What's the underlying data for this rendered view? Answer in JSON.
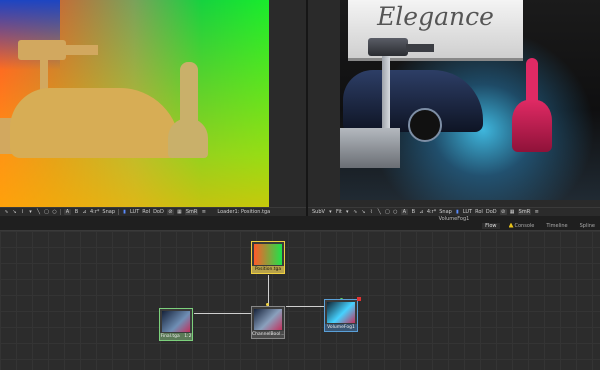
{
  "viewer_left": {
    "toolbar": {
      "icons": [
        "pencil-icon",
        "polyline-icon",
        "bspline-icon",
        "brush-icon",
        "line-icon",
        "rectangle-icon",
        "ellipse-icon"
      ],
      "btn_a": "A",
      "btn_b": "B",
      "ratio": "4:r*",
      "snap": "Snap",
      "lut": "LUT",
      "roi": "RoI",
      "dod": "DoD",
      "smr": "SmR"
    },
    "caption": "Loader1: Position.tga"
  },
  "viewer_right": {
    "backdrop_text": "Elegance",
    "toolbar": {
      "subv": "SubV",
      "fit": "Fit",
      "btn_a": "A",
      "btn_b": "B",
      "ratio": "4:r*",
      "snap": "Snap",
      "lut": "LUT",
      "roi": "RoI",
      "dod": "DoD",
      "smr": "SmR"
    },
    "caption": "VolumeFog1"
  },
  "panel_tabs": [
    "Flow",
    "Console",
    "Timeline",
    "Spline"
  ],
  "nodes": {
    "position": {
      "label": "Position.tga"
    },
    "final": {
      "label": "Final.tga",
      "badge": "1:2"
    },
    "channelbool": {
      "label": "ChannelBool..."
    },
    "volumefog": {
      "label": "VolumeFog1"
    }
  },
  "colors": {
    "position_gradient_left": "#ff4b2b",
    "position_gradient_right": "#19ec2c",
    "position_gradient_bottom": "#ffc800",
    "fog_glow": "#46d2ff",
    "dancer_dress": "#e02a64",
    "node_selected_border": "#7cd07c",
    "node_position_border": "#f0d040"
  }
}
